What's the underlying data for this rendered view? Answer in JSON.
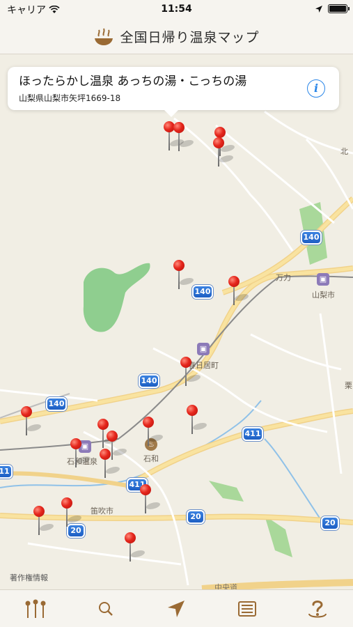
{
  "status_bar": {
    "carrier": "キャリア",
    "time": "11:54",
    "battery_level": 1.0
  },
  "nav": {
    "title": "全国日帰り温泉マップ",
    "logo_icon": "onsen-bowl-icon"
  },
  "callout": {
    "title": "ほったらかし温泉 あっちの湯・こっちの湯",
    "address": "山梨県山梨市矢坪1669-18",
    "info_icon": "i"
  },
  "map": {
    "route_shields": [
      "140",
      "140",
      "140",
      "140",
      "411",
      "411",
      "11",
      "20",
      "20",
      "20"
    ],
    "labels": {
      "yamanashishi": "山梨市",
      "kasugaimachi": "春日居町",
      "isawaonsen": "石和温泉",
      "isawa": "石和",
      "fuefukishi": "笛吹市",
      "mangata": "万力",
      "kita": "北",
      "kuri": "栗",
      "attribution": "著作権情報",
      "bottom_road": "中央道"
    },
    "colors": {
      "pin": "#e5261c",
      "highway": "#f7c65a",
      "park": "#8fce8f",
      "water": "#8fc1e8"
    }
  },
  "tabs": [
    {
      "name": "onsen-list-tab",
      "icon": "thermometers-icon"
    },
    {
      "name": "search-tab",
      "icon": "search-icon"
    },
    {
      "name": "location-tab",
      "icon": "location-arrow-icon"
    },
    {
      "name": "list-tab",
      "icon": "list-icon"
    },
    {
      "name": "help-tab",
      "icon": "help-icon"
    }
  ]
}
